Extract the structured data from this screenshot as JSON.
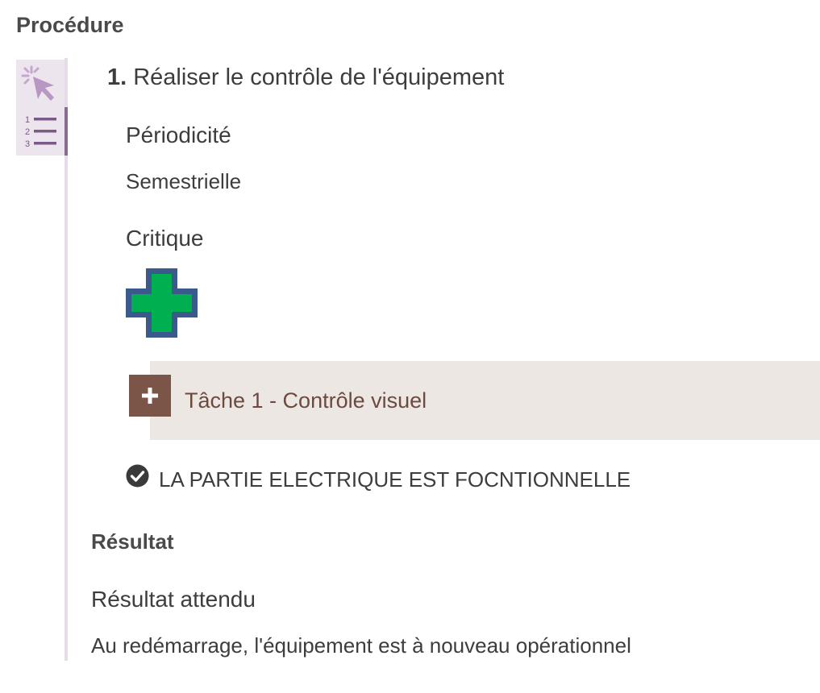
{
  "procedure": {
    "title": "Procédure"
  },
  "sidebar": {
    "pointer_icon": "cursor-click-icon",
    "list_icon": "numbered-list-icon",
    "accent": "#8b6a94",
    "background": "#ece5ee"
  },
  "step": {
    "number": "1.",
    "title": "Réaliser le contrôle de l'équipement"
  },
  "fields": {
    "periodicity_label": "Périodicité",
    "periodicity_value": "Semestrielle",
    "critique_label": "Critique",
    "critique_icon": "green-cross-icon"
  },
  "task": {
    "label": "Tâche 1 - Contrôle visuel",
    "expand_icon": "plus-icon",
    "button_color": "#7a5548",
    "bar_color": "#ede7e4"
  },
  "check": {
    "icon": "check-circle-icon",
    "text": "LA PARTIE ELECTRIQUE EST FOCNTIONNELLE"
  },
  "result": {
    "title": "Résultat",
    "expected_label": "Résultat attendu",
    "expected_value": "Au redémarrage, l'équipement est à nouveau opérationnel"
  }
}
